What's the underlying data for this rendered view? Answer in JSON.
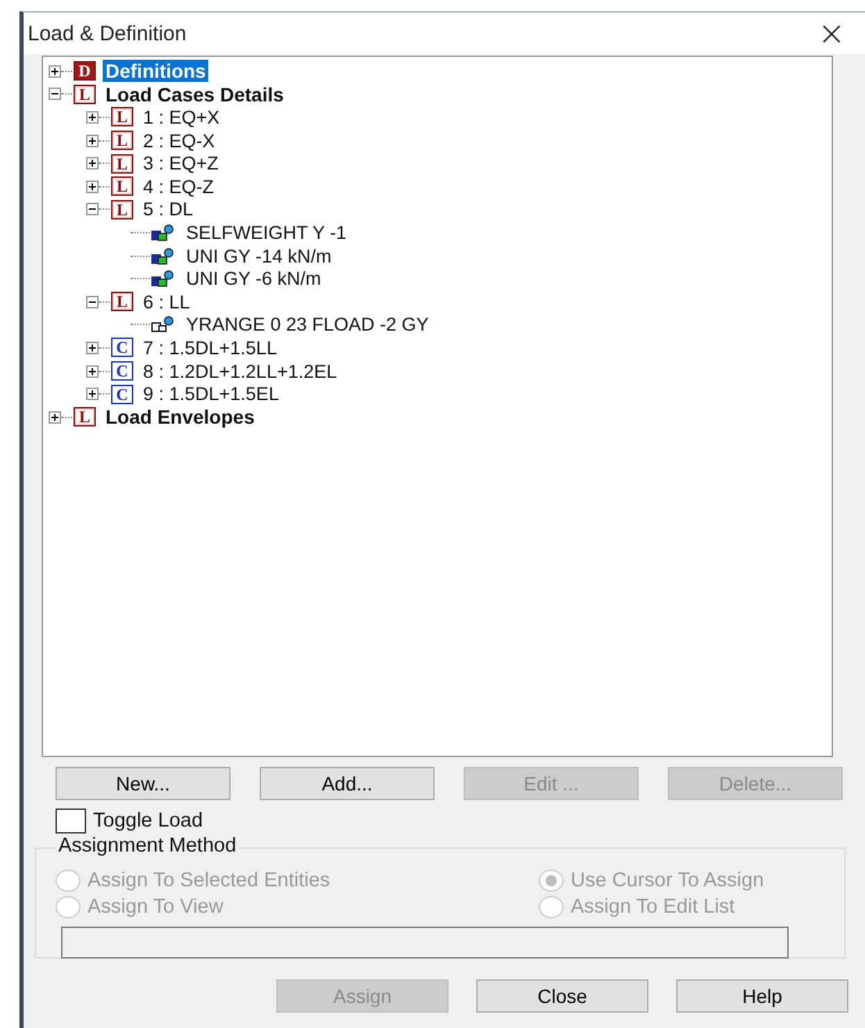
{
  "window": {
    "title": "Load & Definition",
    "close": "×"
  },
  "tree": [
    {
      "kind": "definition",
      "badge": "D",
      "label": "Definitions",
      "expanded": false,
      "selected": true
    },
    {
      "kind": "load",
      "badge": "L",
      "label": "Load Cases Details",
      "expanded": true,
      "selected": false,
      "children": [
        {
          "kind": "load",
          "badge": "L",
          "label": "1 : EQ+X",
          "expanded": false,
          "selected": false
        },
        {
          "kind": "load",
          "badge": "L",
          "label": "2 : EQ-X",
          "expanded": false,
          "selected": false
        },
        {
          "kind": "load",
          "badge": "L",
          "label": "3 : EQ+Z",
          "expanded": false,
          "selected": false
        },
        {
          "kind": "load",
          "badge": "L",
          "label": "4 : EQ-Z",
          "expanded": false,
          "selected": false
        },
        {
          "kind": "load",
          "badge": "L",
          "label": "5 : DL",
          "expanded": true,
          "selected": false,
          "children": [
            {
              "kind": "member_load",
              "label": "SELFWEIGHT Y -1",
              "selected": false
            },
            {
              "kind": "member_load",
              "label": "UNI GY -14 kN/m",
              "selected": false
            },
            {
              "kind": "member_load",
              "label": "UNI GY -6 kN/m",
              "selected": false
            }
          ]
        },
        {
          "kind": "load",
          "badge": "L",
          "label": "6 : LL",
          "expanded": true,
          "selected": false,
          "children": [
            {
              "kind": "floor_load",
              "label": "YRANGE 0 23 FLOAD -2 GY",
              "selected": false
            }
          ]
        },
        {
          "kind": "combination",
          "badge": "C",
          "label": "7 : 1.5DL+1.5LL",
          "expanded": false,
          "selected": false
        },
        {
          "kind": "combination",
          "badge": "C",
          "label": "8 : 1.2DL+1.2LL+1.2EL",
          "expanded": false,
          "selected": false
        },
        {
          "kind": "combination",
          "badge": "C",
          "label": "9 : 1.5DL+1.5EL",
          "expanded": false,
          "selected": false
        }
      ]
    },
    {
      "kind": "load",
      "badge": "L",
      "label": "Load Envelopes",
      "expanded": false,
      "selected": false
    }
  ],
  "buttons": [
    {
      "label": "New...",
      "disabled": false
    },
    {
      "label": "Add...",
      "disabled": false
    },
    {
      "label": "Edit ...",
      "disabled": true
    },
    {
      "label": "Delete...",
      "disabled": true
    }
  ],
  "toggle_load": {
    "label": "Toggle Load",
    "checked": false
  },
  "assignment_method": {
    "title": "Assignment Method",
    "options": [
      {
        "label": "Assign To Selected Entities",
        "selected": false,
        "disabled": true
      },
      {
        "label": "Use Cursor To Assign",
        "selected": true,
        "disabled": true
      },
      {
        "label": "Assign To View",
        "selected": false,
        "disabled": true
      },
      {
        "label": "Assign To Edit List",
        "selected": false,
        "disabled": true
      }
    ]
  },
  "footer_buttons": [
    {
      "label": "Assign",
      "disabled": true
    },
    {
      "label": "Close",
      "disabled": false
    },
    {
      "label": "Help",
      "disabled": false
    }
  ]
}
